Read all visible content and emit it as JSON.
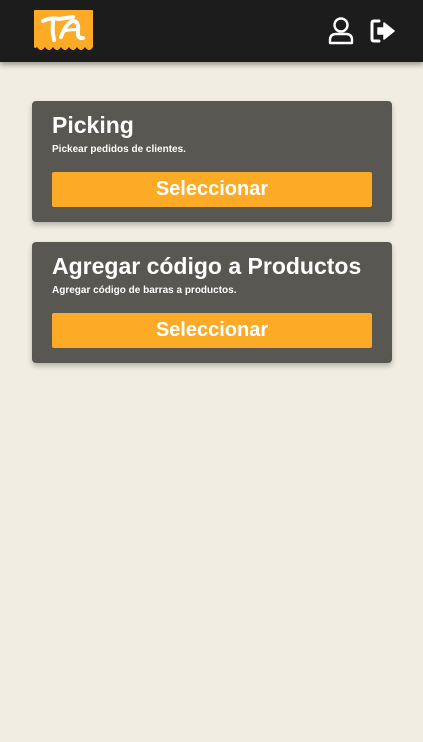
{
  "app": {
    "colors": {
      "background": "#f1ede2",
      "topbar": "#1c1c1c",
      "card": "#595751",
      "accent": "#fdab26",
      "text": "#ffffff"
    }
  },
  "topbar": {
    "logo_icon": "brand-logo-icon",
    "profile_icon": "user-icon",
    "logout_icon": "logout-icon"
  },
  "cards": [
    {
      "title": "Picking",
      "description": "Pickear pedidos de clientes.",
      "button_label": "Seleccionar"
    },
    {
      "title": "Agregar código a Productos",
      "description": "Agregar código de barras a productos.",
      "button_label": "Seleccionar"
    }
  ]
}
